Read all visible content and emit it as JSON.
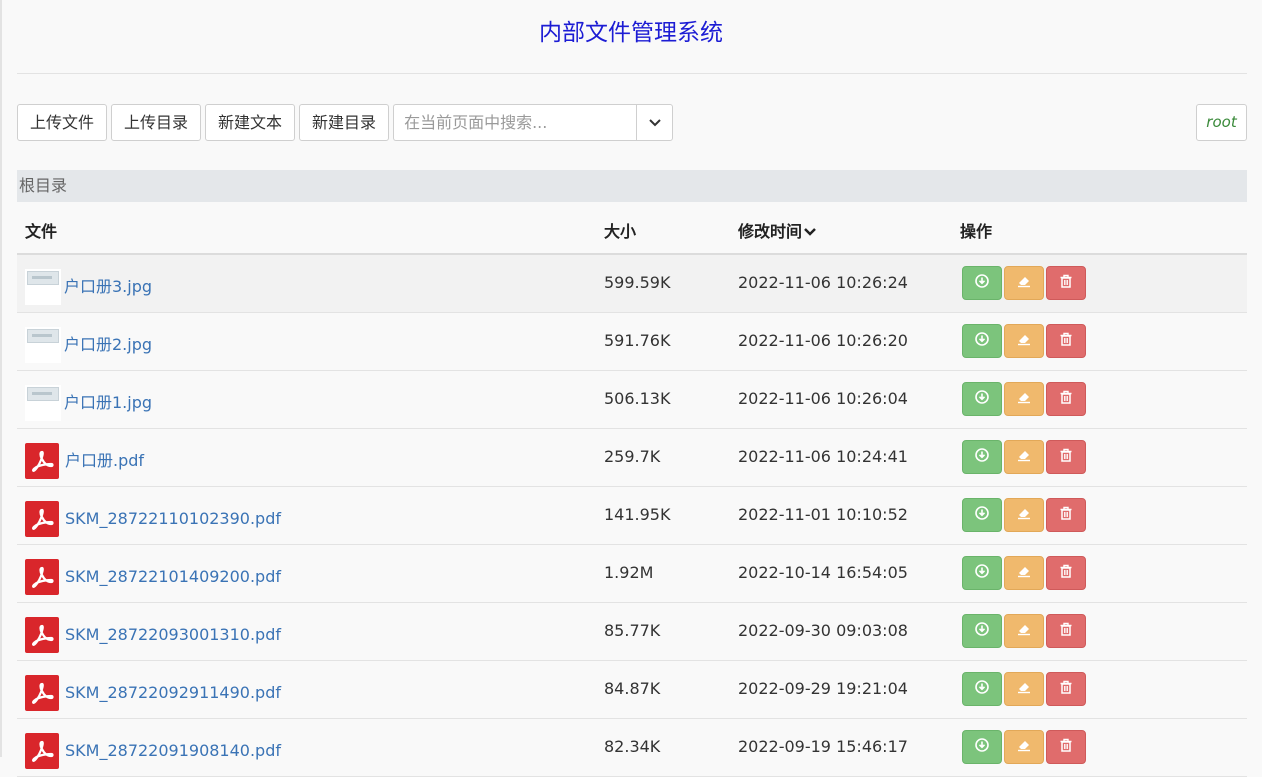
{
  "header": {
    "title": "内部文件管理系统"
  },
  "toolbar": {
    "upload_file": "上传文件",
    "upload_dir": "上传目录",
    "new_text": "新建文本",
    "new_dir": "新建目录",
    "search_placeholder": "在当前页面中搜索...",
    "search_value": ""
  },
  "user": {
    "name": "root"
  },
  "breadcrumb": {
    "current": "根目录"
  },
  "table": {
    "headers": {
      "name": "文件",
      "size": "大小",
      "mtime": "修改时间",
      "ops": "操作"
    },
    "sort_indicator": "chevron-down-icon",
    "rows": [
      {
        "name": "户口册3.jpg",
        "type": "jpg",
        "size": "599.59K",
        "mtime": "2022-11-06 10:26:24"
      },
      {
        "name": "户口册2.jpg",
        "type": "jpg",
        "size": "591.76K",
        "mtime": "2022-11-06 10:26:20"
      },
      {
        "name": "户口册1.jpg",
        "type": "jpg",
        "size": "506.13K",
        "mtime": "2022-11-06 10:26:04"
      },
      {
        "name": "户口册.pdf",
        "type": "pdf",
        "size": "259.7K",
        "mtime": "2022-11-06 10:24:41"
      },
      {
        "name": "SKM_28722110102390.pdf",
        "type": "pdf",
        "size": "141.95K",
        "mtime": "2022-11-01 10:10:52"
      },
      {
        "name": "SKM_28722101409200.pdf",
        "type": "pdf",
        "size": "1.92M",
        "mtime": "2022-10-14 16:54:05"
      },
      {
        "name": "SKM_28722093001310.pdf",
        "type": "pdf",
        "size": "85.77K",
        "mtime": "2022-09-30 09:03:08"
      },
      {
        "name": "SKM_28722092911490.pdf",
        "type": "pdf",
        "size": "84.87K",
        "mtime": "2022-09-29 19:21:04"
      },
      {
        "name": "SKM_28722091908140.pdf",
        "type": "pdf",
        "size": "82.34K",
        "mtime": "2022-09-19 15:46:17"
      }
    ]
  },
  "colors": {
    "title": "#1c1cd4",
    "link": "#3a73b5",
    "download": "#7cc47c",
    "edit": "#f0b96d",
    "delete": "#e06c6c",
    "pdf": "#d9262b"
  }
}
